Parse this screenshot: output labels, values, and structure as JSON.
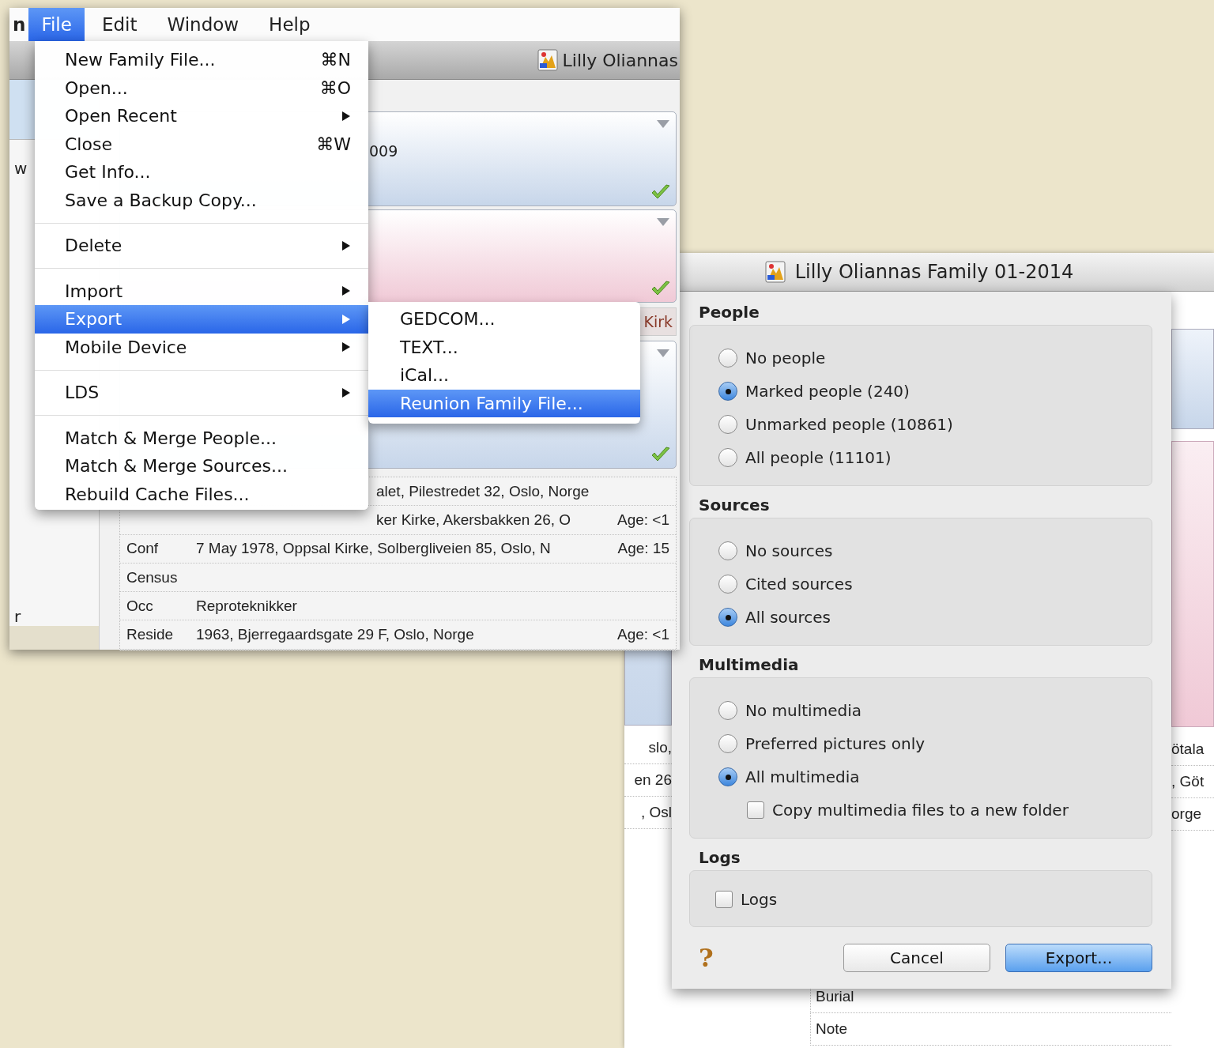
{
  "menu_bar": {
    "app_name": "n",
    "menus": [
      {
        "label": "File",
        "selected": true
      },
      {
        "label": "Edit",
        "selected": false
      },
      {
        "label": "Window",
        "selected": false
      },
      {
        "label": "Help",
        "selected": false
      }
    ]
  },
  "file_menu": {
    "items": [
      {
        "kind": "item",
        "label": "New Family File...",
        "shortcut": "⌘N",
        "submenu": false,
        "selected": false
      },
      {
        "kind": "item",
        "label": "Open...",
        "shortcut": "⌘O",
        "submenu": false,
        "selected": false
      },
      {
        "kind": "item",
        "label": "Open Recent",
        "submenu": true,
        "selected": false
      },
      {
        "kind": "item",
        "label": "Close",
        "shortcut": "⌘W",
        "submenu": false,
        "selected": false
      },
      {
        "kind": "item",
        "label": "Get Info...",
        "submenu": false,
        "selected": false
      },
      {
        "kind": "item",
        "label": "Save a Backup Copy...",
        "submenu": false,
        "selected": false
      },
      {
        "kind": "separator"
      },
      {
        "kind": "item",
        "label": "Delete",
        "submenu": true,
        "selected": false
      },
      {
        "kind": "separator"
      },
      {
        "kind": "item",
        "label": "Import",
        "submenu": true,
        "selected": false
      },
      {
        "kind": "item",
        "label": "Export",
        "submenu": true,
        "selected": true
      },
      {
        "kind": "item",
        "label": "Mobile Device",
        "submenu": true,
        "selected": false
      },
      {
        "kind": "separator"
      },
      {
        "kind": "item",
        "label": "LDS",
        "submenu": true,
        "selected": false
      },
      {
        "kind": "separator"
      },
      {
        "kind": "item",
        "label": "Match & Merge People...",
        "submenu": false,
        "selected": false
      },
      {
        "kind": "item",
        "label": "Match & Merge Sources...",
        "submenu": false,
        "selected": false
      },
      {
        "kind": "item",
        "label": "Rebuild Cache Files...",
        "submenu": false,
        "selected": false
      }
    ]
  },
  "export_submenu": {
    "items": [
      {
        "label": "GEDCOM...",
        "selected": false
      },
      {
        "label": "TEXT...",
        "selected": false
      },
      {
        "label": "iCal...",
        "selected": false
      },
      {
        "label": "Reunion Family File...",
        "selected": true
      }
    ]
  },
  "family_window": {
    "title": "Lilly Oliannas",
    "sidebar_texts": [
      "w",
      "r"
    ],
    "cards": [
      {
        "color": "#c7d6ea",
        "text": "009"
      },
      {
        "color": "#f0c9d6"
      },
      {
        "color": "#c7d6ea"
      }
    ],
    "tab_label": "Kirk",
    "events": [
      {
        "kind": "partial",
        "value": "alet, Pilestredet 32, Oslo, Norge"
      },
      {
        "kind": "partial",
        "value": "ker Kirke, Akersbakken 26, O",
        "age": "Age: <1"
      },
      {
        "kind": "full",
        "label": "Conf",
        "value": "7 May 1978, Oppsal Kirke, Solbergliveien 85, Oslo, N",
        "age": "Age: 15"
      },
      {
        "kind": "full",
        "label": "Census"
      },
      {
        "kind": "full",
        "label": "Occ",
        "value": "Reproteknikker"
      },
      {
        "kind": "full",
        "label": "Reside",
        "value": "1963, Bjerregaardsgate 29 F, Oslo, Norge",
        "age": "Age: <1"
      }
    ]
  },
  "export_dialog": {
    "window_title": "Lilly Oliannas Family 01-2014",
    "groups": [
      {
        "title": "People",
        "options": [
          {
            "kind": "radio",
            "label": "No people",
            "selected": false
          },
          {
            "kind": "radio",
            "label": "Marked people (240)",
            "selected": true
          },
          {
            "kind": "radio",
            "label": "Unmarked people (10861)",
            "selected": false
          },
          {
            "kind": "radio",
            "label": "All people (11101)",
            "selected": false
          }
        ]
      },
      {
        "title": "Sources",
        "options": [
          {
            "kind": "radio",
            "label": "No sources",
            "selected": false
          },
          {
            "kind": "radio",
            "label": "Cited sources",
            "selected": false
          },
          {
            "kind": "radio",
            "label": "All sources",
            "selected": true
          }
        ]
      },
      {
        "title": "Multimedia",
        "options": [
          {
            "kind": "radio",
            "label": "No multimedia",
            "selected": false
          },
          {
            "kind": "radio",
            "label": "Preferred pictures only",
            "selected": false
          },
          {
            "kind": "radio",
            "label": "All multimedia",
            "selected": true
          },
          {
            "kind": "checkbox",
            "label": "Copy multimedia files to a new folder",
            "checked": false
          }
        ]
      },
      {
        "title": "Logs",
        "options": [
          {
            "kind": "checkbox",
            "label": "Logs",
            "checked": false
          }
        ]
      }
    ],
    "help_label": "?",
    "buttons": [
      {
        "label": "Cancel",
        "default": false
      },
      {
        "label": "Export...",
        "default": true
      }
    ]
  },
  "background_window": {
    "left_texts": [
      "slo,",
      "en 26",
      ", Osl"
    ],
    "right_texts": [
      "ötala",
      ", Göt",
      "orge"
    ],
    "event_labels": [
      "Burial",
      "Note"
    ]
  }
}
